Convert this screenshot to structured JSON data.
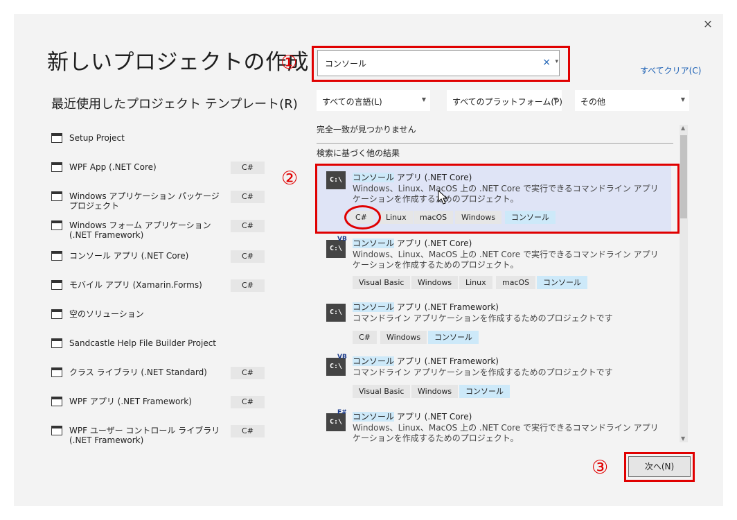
{
  "dialog": {
    "close_glyph": "×",
    "title": "新しいプロジェクトの作成",
    "recent_heading": "最近使用したプロジェクト テンプレート(R)"
  },
  "annotations": {
    "n1": "①",
    "n2": "②",
    "n3": "③"
  },
  "search": {
    "value": "コンソール",
    "clear_glyph": "×",
    "dropdown_glyph": "▾",
    "clear_all": "すべてクリア(C)"
  },
  "filters": [
    {
      "label": "すべての言語(L)"
    },
    {
      "label": "すべてのプラットフォーム(P)"
    },
    {
      "label": "その他"
    }
  ],
  "recent": [
    {
      "label": "Setup Project",
      "tag": "",
      "icon": "setup-project-icon"
    },
    {
      "label": "WPF App (.NET Core)",
      "tag": "C#",
      "icon": "wpf-app-icon"
    },
    {
      "label": "Windows アプリケーション パッケージ プロジェクト",
      "tag": "C#",
      "icon": "package-project-icon"
    },
    {
      "label": "Windows フォーム アプリケーション (.NET Framework)",
      "tag": "C#",
      "icon": "winforms-icon"
    },
    {
      "label": "コンソール アプリ (.NET Core)",
      "tag": "C#",
      "icon": "console-app-icon"
    },
    {
      "label": "モバイル アプリ (Xamarin.Forms)",
      "tag": "C#",
      "icon": "mobile-app-icon"
    },
    {
      "label": "空のソリューション",
      "tag": "",
      "icon": "blank-solution-icon"
    },
    {
      "label": "Sandcastle Help File Builder Project",
      "tag": "",
      "icon": "sandcastle-icon"
    },
    {
      "label": "クラス ライブラリ (.NET Standard)",
      "tag": "C#",
      "icon": "class-library-icon"
    },
    {
      "label": "WPF アプリ (.NET Framework)",
      "tag": "C#",
      "icon": "wpf-framework-icon"
    },
    {
      "label": "WPF ユーザー コントロール ライブラリ (.NET Framework)",
      "tag": "C#",
      "icon": "wpf-user-control-icon"
    }
  ],
  "results_panel": {
    "no_exact_match": "完全一致が見つかりません",
    "other_results": "検索に基づく他の結果"
  },
  "results": [
    {
      "title_hl": "コンソール",
      "title_rest": " アプリ (.NET Core)",
      "desc": "Windows、Linux、MacOS 上の .NET Core で実行できるコマンドライン アプリケーションを作成するためのプロジェクト。",
      "tags": [
        "C#",
        "Linux",
        "macOS",
        "Windows",
        "コンソール"
      ],
      "icon_text": "C:\\",
      "badge": ""
    },
    {
      "title_hl": "コンソール",
      "title_rest": " アプリ (.NET Core)",
      "desc": "Windows、Linux、MacOS 上の .NET Core で実行できるコマンドライン アプリケーションを作成するためのプロジェクト。",
      "tags": [
        "Visual Basic",
        "Windows",
        "Linux",
        "macOS",
        "コンソール"
      ],
      "icon_text": "C:\\",
      "badge": "VB"
    },
    {
      "title_hl": "コンソール",
      "title_rest": " アプリ (.NET Framework)",
      "desc": "コマンドライン アプリケーションを作成するためのプロジェクトです",
      "tags": [
        "C#",
        "Windows",
        "コンソール"
      ],
      "icon_text": "C:\\",
      "badge": ""
    },
    {
      "title_hl": "コンソール",
      "title_rest": " アプリ (.NET Framework)",
      "desc": "コマンドライン アプリケーションを作成するためのプロジェクトです",
      "tags": [
        "Visual Basic",
        "Windows",
        "コンソール"
      ],
      "icon_text": "C:\\",
      "badge": "VB"
    },
    {
      "title_hl": "コンソール",
      "title_rest": " アプリ (.NET Core)",
      "desc": "Windows、Linux、MacOS 上の .NET Core で実行できるコマンドライン アプリケーションを作成するためのプロジェクト。",
      "tags": [],
      "icon_text": "C:\\",
      "badge": "F#"
    }
  ],
  "footer": {
    "next_label": "次へ(N)"
  },
  "colors": {
    "accent": "#1a5fb4",
    "annotation_red": "#e00000",
    "selected_bg": "#dfe4f6",
    "highlight_bg": "#cde9f9"
  }
}
